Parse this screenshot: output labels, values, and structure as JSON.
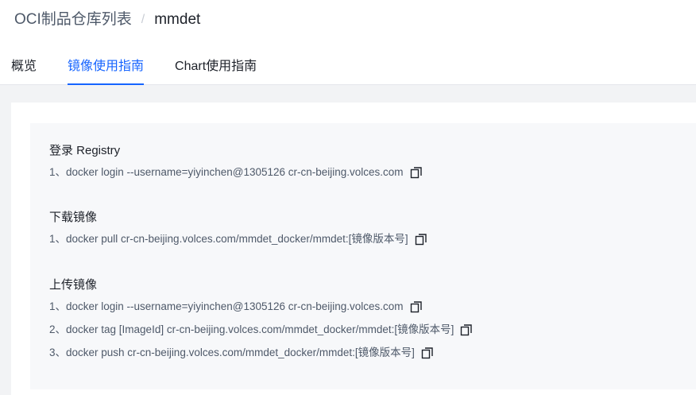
{
  "breadcrumb": {
    "root": "OCI制品仓库列表",
    "separator": "/",
    "current": "mmdet"
  },
  "tabs": [
    {
      "label": "概览",
      "active": false
    },
    {
      "label": "镜像使用指南",
      "active": true
    },
    {
      "label": "Chart使用指南",
      "active": false
    }
  ],
  "sections": {
    "login": {
      "title": "登录 Registry",
      "commands": [
        "1、docker login --username=yiyinchen@1305126 cr-cn-beijing.volces.com"
      ]
    },
    "pull": {
      "title": "下载镜像",
      "commands": [
        "1、docker pull cr-cn-beijing.volces.com/mmdet_docker/mmdet:[镜像版本号]"
      ]
    },
    "push": {
      "title": "上传镜像",
      "commands": [
        "1、docker login --username=yiyinchen@1305126 cr-cn-beijing.volces.com",
        "2、docker tag [ImageId] cr-cn-beijing.volces.com/mmdet_docker/mmdet:[镜像版本号]",
        "3、docker push cr-cn-beijing.volces.com/mmdet_docker/mmdet:[镜像版本号]"
      ]
    }
  },
  "icons": {
    "copy": "copy-icon"
  },
  "colors": {
    "accent": "#1664ff",
    "text_primary": "#1d2129",
    "text_secondary": "#4e5969",
    "guide_background": "#f7f8fa",
    "page_background": "#f2f3f5"
  }
}
